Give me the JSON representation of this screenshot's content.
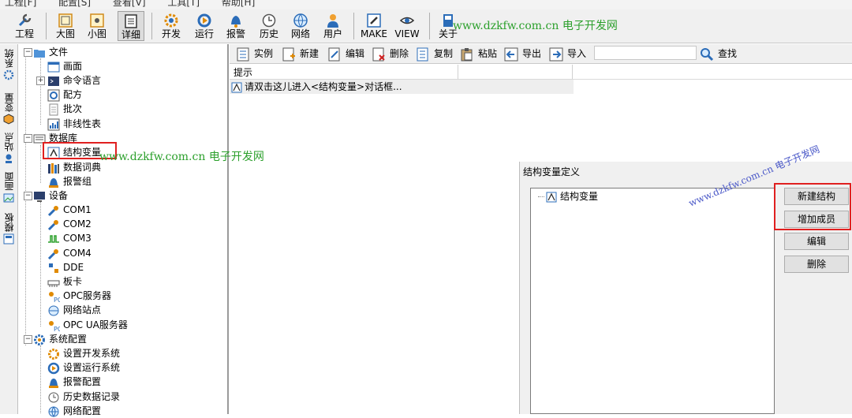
{
  "menu": [
    "工程[F]",
    "配置[S]",
    "查看[V]",
    "工具[T]",
    "帮助[H]"
  ],
  "toolbar": {
    "project": "工程",
    "large_icons": "大图",
    "small_icons": "小图",
    "details": "详细",
    "develop": "开发",
    "run": "运行",
    "alarm": "报警",
    "history": "历史",
    "network": "网络",
    "user": "用户",
    "make": "MAKE",
    "view": "VIEW",
    "about": "关于"
  },
  "watermark": "www.dzkfw.com.cn 电子开发网",
  "side_tabs": [
    "系统",
    "变量",
    "站点",
    "画面",
    "模板"
  ],
  "tree": {
    "file": "文件",
    "screen": "画面",
    "command_lang": "命令语言",
    "recipe": "配方",
    "batch": "批次",
    "nonlinear_table": "非线性表",
    "database": "数据库",
    "struct_var": "结构变量",
    "data_dict": "数据词典",
    "alarm_group": "报警组",
    "device": "设备",
    "com1": "COM1",
    "com2": "COM2",
    "com3": "COM3",
    "com4": "COM4",
    "dde": "DDE",
    "board": "板卡",
    "opc_server": "OPC服务器",
    "net_station": "网络站点",
    "opc_ua_server": "OPC UA服务器",
    "sys_config": "系统配置",
    "set_dev_sys": "设置开发系统",
    "set_run_sys": "设置运行系统",
    "alarm_config": "报警配置",
    "history_record": "历史数据记录",
    "net_config": "网络配置"
  },
  "right_toolbar": {
    "instance": "实例",
    "new": "新建",
    "edit": "编辑",
    "delete": "删除",
    "copy": "复制",
    "paste": "粘贴",
    "export": "导出",
    "import": "导入",
    "search_value": "",
    "find": "查找"
  },
  "list": {
    "col1": "提示",
    "row1": "请双击这儿进入<结构变量>对话框..."
  },
  "dialog": {
    "title": "结构变量定义",
    "root": "结构变量",
    "new_struct": "新建结构",
    "add_member": "增加成员",
    "edit": "编辑",
    "delete": "删除"
  },
  "colors": {
    "highlight_box": "#e02020",
    "watermark_green": "#2ca02c",
    "watermark_blue": "#4a58c8"
  }
}
